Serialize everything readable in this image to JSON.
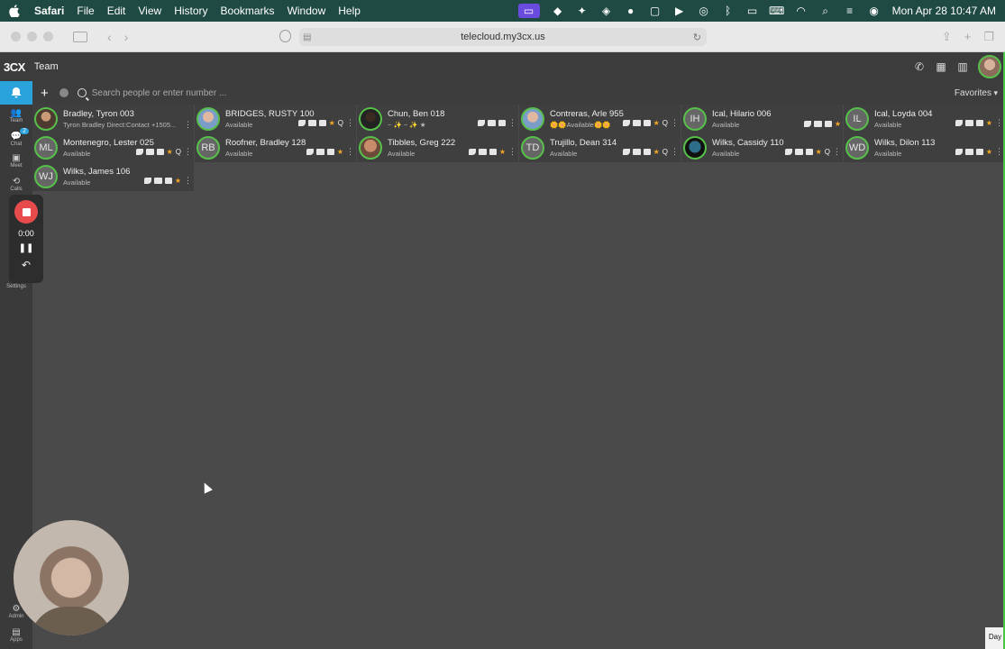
{
  "menubar": {
    "app": "Safari",
    "items": [
      "File",
      "Edit",
      "View",
      "History",
      "Bookmarks",
      "Window",
      "Help"
    ],
    "clock": "Mon Apr 28  10:47 AM"
  },
  "browser": {
    "url": "telecloud.my3cx.us"
  },
  "app": {
    "logo": "3CX",
    "section_title": "Team"
  },
  "rail": {
    "items": [
      {
        "label": "Team",
        "icon": "team-icon"
      },
      {
        "label": "Chat",
        "icon": "chat-icon",
        "badge": "2"
      },
      {
        "label": "Meet",
        "icon": "meet-icon"
      },
      {
        "label": "Calls",
        "icon": "calls-icon"
      },
      {
        "label": "Settings",
        "icon": "settings-icon"
      },
      {
        "label": "Admin",
        "icon": "admin-icon"
      },
      {
        "label": "Apps",
        "icon": "apps-icon"
      }
    ]
  },
  "recorder": {
    "time": "0:00"
  },
  "toolbar": {
    "search_placeholder": "Search people or enter number ...",
    "filter": "Favorites"
  },
  "contacts": [
    {
      "name": "Bradley, Tyron 003",
      "status": "Tyron Bradley Direct:Contact +1505...",
      "initials": "",
      "avatar": "photo",
      "star": false,
      "q": false
    },
    {
      "name": "BRIDGES, RUSTY 100",
      "status": "Available",
      "initials": "",
      "avatar": "photo3",
      "star": true,
      "q": true
    },
    {
      "name": "Chun, Ben 018",
      "status": "~ ✨ ~ ✨ ★",
      "initials": "",
      "avatar": "photo2",
      "star": false,
      "q": false
    },
    {
      "name": "Contreras, Arle 955",
      "status": "🌼🌼Available🌼🌼",
      "initials": "",
      "avatar": "photo3",
      "star": true,
      "q": true
    },
    {
      "name": "Ical, Hilario 006",
      "status": "Available",
      "initials": "IH",
      "avatar": "",
      "star": true,
      "q": false
    },
    {
      "name": "Ical, Loyda 004",
      "status": "Available",
      "initials": "IL",
      "avatar": "",
      "star": true,
      "q": false
    },
    {
      "name": "Montenegro, Lester 025",
      "status": "Available",
      "initials": "ML",
      "avatar": "",
      "star": true,
      "q": true
    },
    {
      "name": "Roofner, Bradley 128",
      "status": "Available",
      "initials": "RB",
      "avatar": "",
      "star": true,
      "q": false
    },
    {
      "name": "Tibbles, Greg 222",
      "status": "Available",
      "initials": "",
      "avatar": "photo5",
      "star": true,
      "q": false
    },
    {
      "name": "Trujillo, Dean 314",
      "status": "Available",
      "initials": "TD",
      "avatar": "",
      "star": true,
      "q": true
    },
    {
      "name": "Wilks, Cassidy 110",
      "status": "Available",
      "initials": "",
      "avatar": "photo4",
      "star": true,
      "q": true
    },
    {
      "name": "Wilks, Dilon 113",
      "status": "Available",
      "initials": "WD",
      "avatar": "",
      "star": true,
      "q": false
    },
    {
      "name": "Wilks, James 106",
      "status": "Available",
      "initials": "WJ",
      "avatar": "",
      "star": true,
      "q": false
    }
  ],
  "corner_button": "Day",
  "colors": {
    "accent": "#2aa3dd",
    "presence": "#57c04a",
    "favorite": "#f5a623",
    "record": "#e84b4b"
  }
}
